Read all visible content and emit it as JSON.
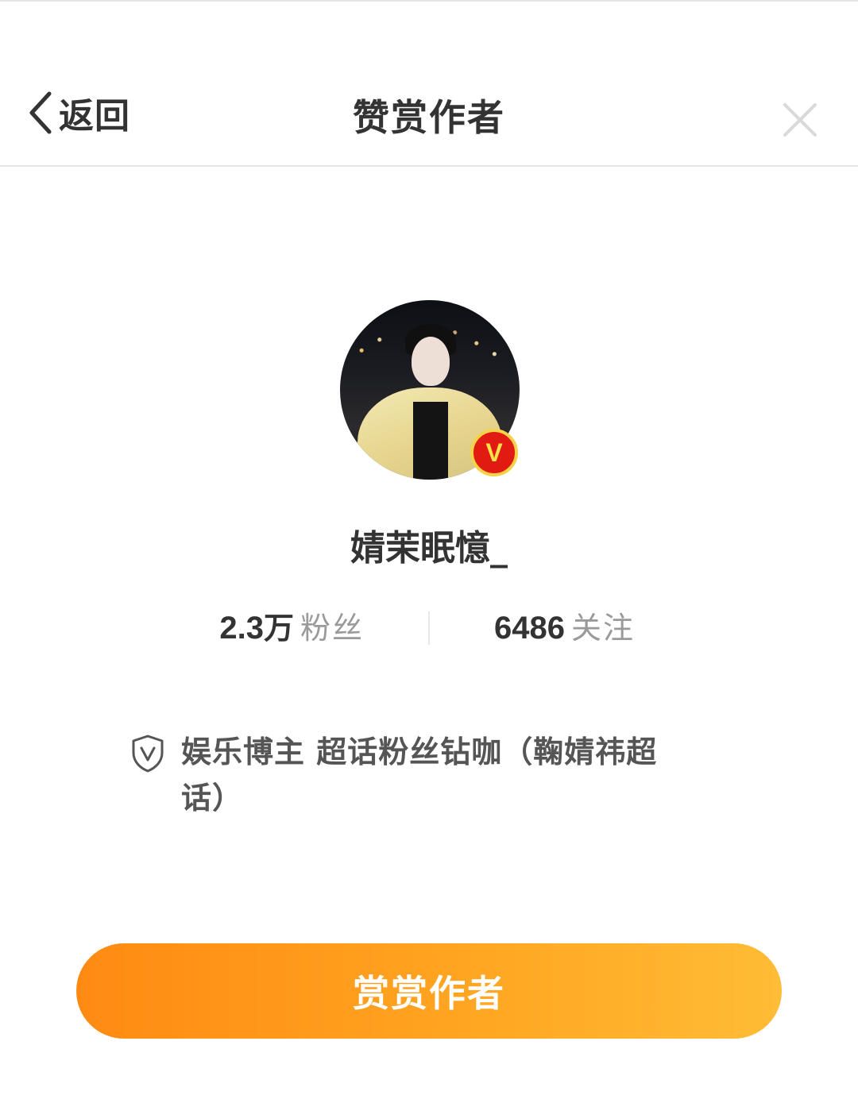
{
  "nav": {
    "back_label": "返回",
    "title": "赞赏作者",
    "back_icon": "chevron-left-icon",
    "close_icon": "close-icon"
  },
  "profile": {
    "name": "婧茉眠憶_",
    "verified_badge": "V",
    "stats": {
      "followers_value": "2.3",
      "followers_unit": "万",
      "followers_label": "粉丝",
      "following_value": "6486",
      "following_label": "关注"
    },
    "verification_icon": "shield-v-icon",
    "verification": "娱乐博主 超话粉丝钻咖（鞠婧祎超话）"
  },
  "action": {
    "reward_label": "赏赏作者"
  },
  "colors": {
    "accent_start": "#ff8a13",
    "accent_end": "#ffbc36",
    "badge_red": "#e11a12",
    "badge_gold": "#f6d24a"
  }
}
